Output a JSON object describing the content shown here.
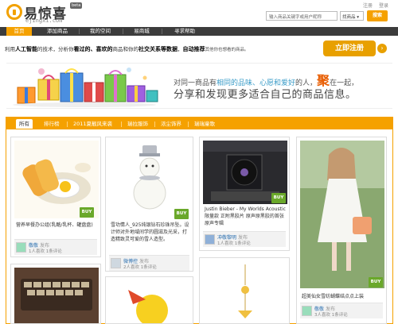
{
  "header": {
    "logo_text": "易惊喜",
    "logo_sub": "ejingxi.com",
    "beta": "beta",
    "links": [
      "注册",
      "登录"
    ],
    "search_placeholder": "输入商品关键字或用户昵称",
    "search_scope": "找商品",
    "search_button": "搜索"
  },
  "nav": {
    "items": [
      "首页",
      "添加商品",
      "我的空间",
      "易商城",
      "寻求帮助"
    ],
    "active_index": 0
  },
  "intro": {
    "p1": "利用",
    "b1": "人工智能",
    "p2": "的技术，分析你",
    "b2": "看过的、喜欢的",
    "p3": "商品和你的",
    "b3": "社交关系等数据",
    "p4": "，",
    "b4": "自动推荐",
    "p5": "其他你也想看的商品。",
    "register": "立即注册",
    "arrow": "›"
  },
  "banner": {
    "line1_a": "对同一商品有",
    "line1_b": "相同的品味、心愿和爱好",
    "line1_c": "的人，",
    "line1_d": "聚",
    "line1_e": "在一起，",
    "line2": "分享和发现更多适合自己的商品信息。"
  },
  "filters": {
    "items": [
      "所有",
      "排行榜",
      "2011夏靓风来袭",
      "瑞拉服饰",
      "浓尘饰界",
      "瑞瑞童歌"
    ],
    "active_index": 0
  },
  "cards": [
    {
      "title": "营养早餐办公组(乳酪/乳杯、罐盘盘)",
      "buy": "BUY",
      "user": "敬敬",
      "pub": "发布",
      "stats": "1人喜欢 1条评论"
    },
    {
      "title": "雪功情人_925纯银钻石珍珠吊坠。设计师对外地域间学的圆滋及光采，打造精致灵可爱的雪人造型。",
      "buy": "BUY",
      "user": "微博控",
      "pub": "发布",
      "stats": "2人喜欢 1条评论"
    },
    {
      "title": "Justin Bieber - My Worlds Acoustic限量款 正附黑胶片 原声原黑胶的首张原声专辑",
      "buy": "BUY",
      "user": "冲敬黎明",
      "pub": "发布",
      "stats": "1人喜欢 1条评论"
    },
    {
      "title": "超美仙女雪纺蝴蝶结点点上装",
      "buy": "BUY",
      "user": "敬敬",
      "pub": "发布",
      "stats": "3人喜欢 1条评论"
    }
  ]
}
